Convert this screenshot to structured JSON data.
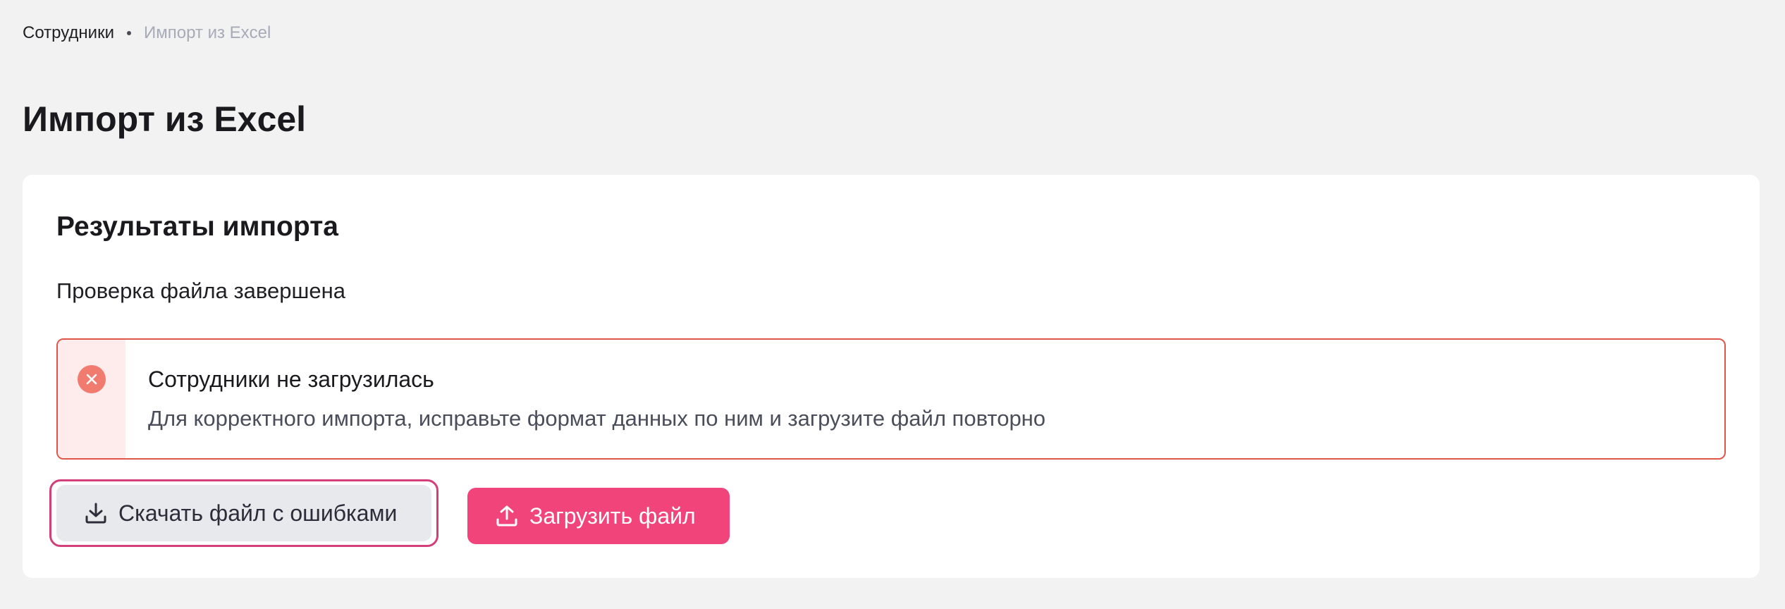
{
  "breadcrumb": {
    "parent": "Сотрудники",
    "current": "Импорт из Excel"
  },
  "page": {
    "title": "Импорт из Excel"
  },
  "card": {
    "title": "Результаты импорта",
    "status": "Проверка файла завершена"
  },
  "alert": {
    "icon": "close-circle-icon",
    "title": "Сотрудники не загрузилась",
    "description": "Для корректного импорта, исправьте формат данных по ним и загрузите файл повторно"
  },
  "actions": {
    "download_errors_label": "Скачать файл с ошибками",
    "download_icon": "download-icon",
    "upload_label": "Загрузить файл",
    "upload_icon": "upload-icon"
  },
  "colors": {
    "accent": "#f0447a",
    "error": "#e0574a",
    "focus_ring": "#d23f7a"
  }
}
